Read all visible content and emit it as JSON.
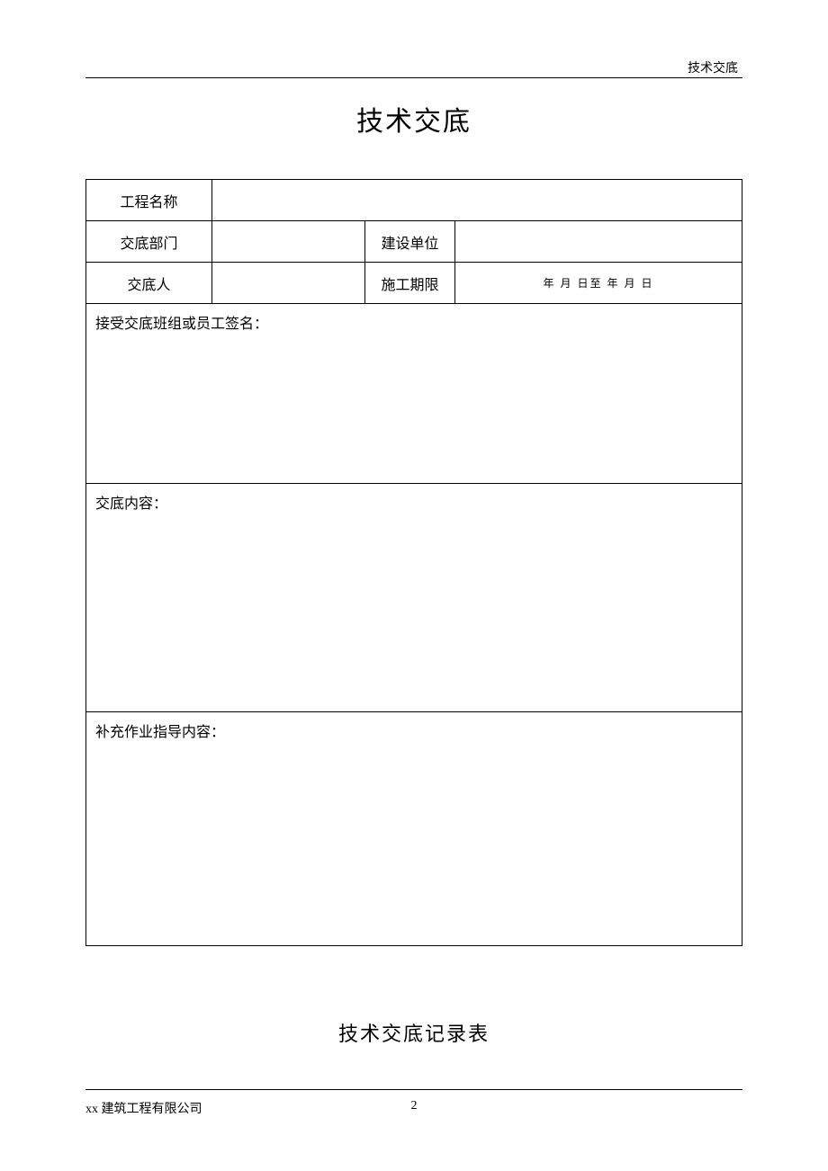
{
  "header": {
    "right_text": "技术交底"
  },
  "title": "技术交底",
  "form": {
    "project_name_label": "工程名称",
    "project_name_value": "",
    "dept_label": "交底部门",
    "dept_value": "",
    "construction_unit_label": "建设单位",
    "construction_unit_value": "",
    "disclosure_person_label": "交底人",
    "disclosure_person_value": "",
    "construction_period_label": "施工期限",
    "construction_period_value": "年  月  日至   年  月   日",
    "signature_label": "接受交底班组或员工签名：",
    "content_label": "交底内容：",
    "supplement_label": "补充作业指导内容："
  },
  "subtitle": "技术交底记录表",
  "footer": {
    "company": "xx 建筑工程有限公司",
    "page_number": "2"
  }
}
